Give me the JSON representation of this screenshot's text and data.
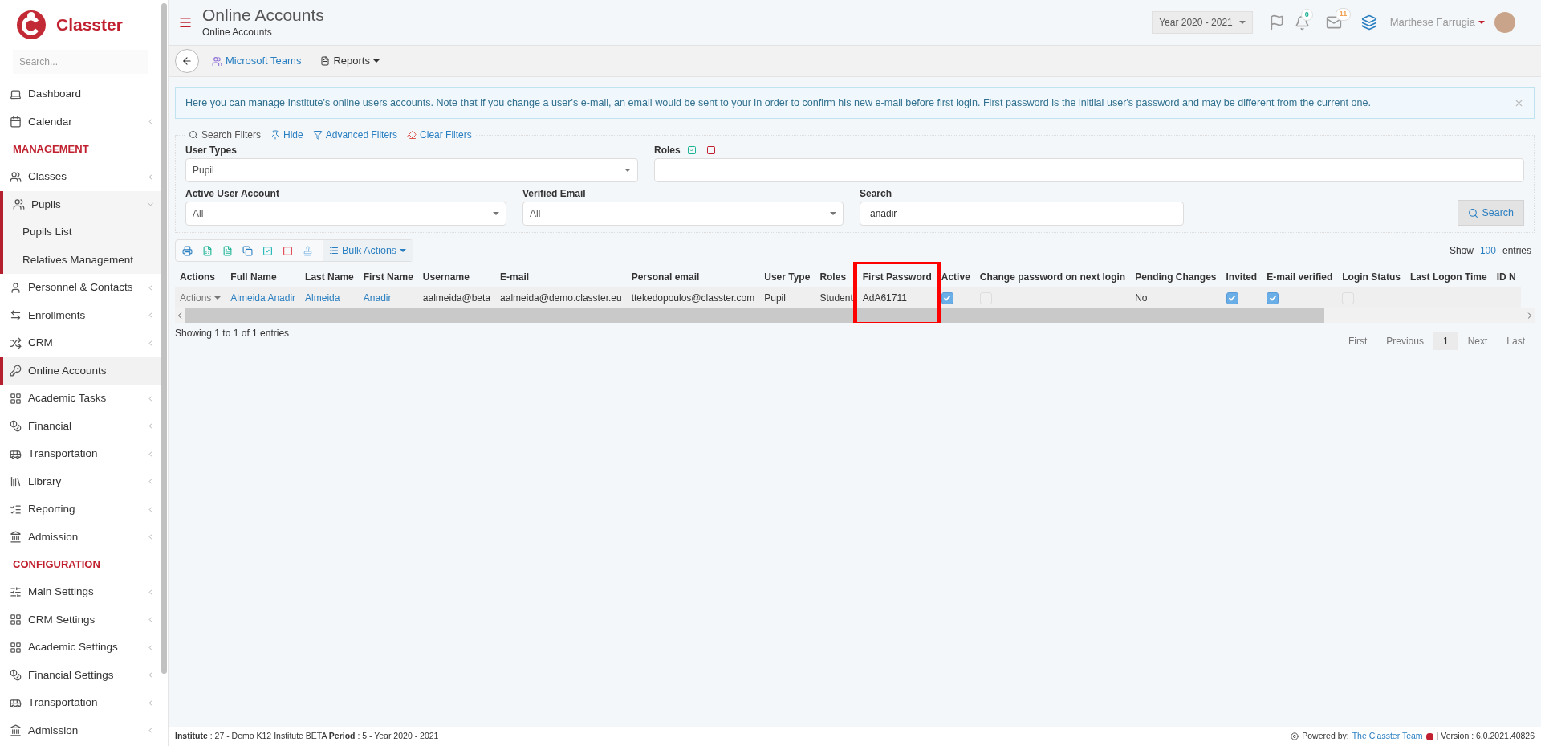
{
  "brand": {
    "name": "Classter"
  },
  "sidebar": {
    "search_placeholder": "Search...",
    "items": [
      {
        "kind": "item",
        "label": "Dashboard",
        "selected": false,
        "chevron": false
      },
      {
        "kind": "item",
        "label": "Calendar",
        "selected": false,
        "chevron": true
      },
      {
        "kind": "heading",
        "label": "MANAGEMENT"
      },
      {
        "kind": "item",
        "label": "Classes",
        "selected": false,
        "chevron": true
      },
      {
        "kind": "item",
        "label": "Pupils",
        "selected": false,
        "chevron": true,
        "expanded": true,
        "children": [
          {
            "label": "Pupils List"
          },
          {
            "label": "Relatives Management"
          }
        ]
      },
      {
        "kind": "item",
        "label": "Personnel & Contacts",
        "selected": false,
        "chevron": true
      },
      {
        "kind": "item",
        "label": "Enrollments",
        "selected": false,
        "chevron": true
      },
      {
        "kind": "item",
        "label": "CRM",
        "selected": false,
        "chevron": true
      },
      {
        "kind": "item",
        "label": "Online Accounts",
        "selected": true,
        "chevron": false
      },
      {
        "kind": "item",
        "label": "Academic Tasks",
        "selected": false,
        "chevron": true
      },
      {
        "kind": "item",
        "label": "Financial",
        "selected": false,
        "chevron": true
      },
      {
        "kind": "item",
        "label": "Transportation",
        "selected": false,
        "chevron": true
      },
      {
        "kind": "item",
        "label": "Library",
        "selected": false,
        "chevron": true
      },
      {
        "kind": "item",
        "label": "Reporting",
        "selected": false,
        "chevron": true
      },
      {
        "kind": "item",
        "label": "Admission",
        "selected": false,
        "chevron": true
      },
      {
        "kind": "heading",
        "label": "CONFIGURATION"
      },
      {
        "kind": "item",
        "label": "Main Settings",
        "selected": false,
        "chevron": true
      },
      {
        "kind": "item",
        "label": "CRM Settings",
        "selected": false,
        "chevron": true
      },
      {
        "kind": "item",
        "label": "Academic Settings",
        "selected": false,
        "chevron": true
      },
      {
        "kind": "item",
        "label": "Financial Settings",
        "selected": false,
        "chevron": true
      },
      {
        "kind": "item",
        "label": "Transportation",
        "selected": false,
        "chevron": true
      },
      {
        "kind": "item",
        "label": "Admission",
        "selected": false,
        "chevron": true
      }
    ]
  },
  "header": {
    "title": "Online Accounts",
    "subtitle": "Online Accounts",
    "year": "Year 2020 - 2021",
    "notifications": "0",
    "messages": "11",
    "user": "Marthese Farrugia"
  },
  "toolbar": {
    "teams": "Microsoft Teams",
    "reports": "Reports"
  },
  "info": "Here you can manage Institute's online users accounts. Note that if you change a user's e-mail, an email would be sent to your in order to confirm his new e-mail before first login. First password is the initiial user's password and may be different from the current one.",
  "filters": {
    "links": [
      "Search Filters",
      "Hide",
      "Advanced Filters",
      "Clear Filters"
    ],
    "user_types": {
      "label": "User Types",
      "value": "Pupil"
    },
    "roles": {
      "label": "Roles"
    },
    "active": {
      "label": "Active User Account",
      "value": "All"
    },
    "verified": {
      "label": "Verified Email",
      "value": "All"
    },
    "search": {
      "label": "Search",
      "value": "anadir"
    },
    "search_button": "Search"
  },
  "table": {
    "bulk": "Bulk Actions",
    "show": "Show",
    "page_size": "100",
    "entries": "entries",
    "columns": [
      {
        "label": "Actions",
        "highlighted": false
      },
      {
        "label": "Full Name",
        "highlighted": false
      },
      {
        "label": "Last Name",
        "highlighted": false
      },
      {
        "label": "First Name",
        "highlighted": false
      },
      {
        "label": "Username",
        "highlighted": false
      },
      {
        "label": "E-mail",
        "highlighted": false
      },
      {
        "label": "Personal email",
        "highlighted": false
      },
      {
        "label": "User Type",
        "highlighted": false
      },
      {
        "label": "Roles",
        "highlighted": false
      },
      {
        "label": "First Password",
        "highlighted": true
      },
      {
        "label": "Active",
        "highlighted": false
      },
      {
        "label": "Change password on next login",
        "highlighted": false
      },
      {
        "label": "Pending Changes",
        "highlighted": false
      },
      {
        "label": "Invited",
        "highlighted": false
      },
      {
        "label": "E-mail verified",
        "highlighted": false
      },
      {
        "label": "Login Status",
        "highlighted": false
      },
      {
        "label": "Last Logon Time",
        "highlighted": false
      },
      {
        "label": "ID N",
        "highlighted": false
      }
    ],
    "rows": [
      [
        {
          "kind": "menu",
          "text": "Actions"
        },
        {
          "kind": "link",
          "text": "Almeida Anadir"
        },
        {
          "kind": "link",
          "text": "Almeida"
        },
        {
          "kind": "link",
          "text": "Anadir"
        },
        {
          "kind": "text",
          "text": "aalmeida@beta"
        },
        {
          "kind": "text",
          "text": "aalmeida@demo.classter.eu"
        },
        {
          "kind": "text",
          "text": "ttekedopoulos@classter.com"
        },
        {
          "kind": "text",
          "text": "Pupil"
        },
        {
          "kind": "text",
          "text": "Student"
        },
        {
          "kind": "text",
          "text": "AdA61711"
        },
        {
          "kind": "check",
          "checked": true
        },
        {
          "kind": "check",
          "checked": false
        },
        {
          "kind": "text",
          "text": "No"
        },
        {
          "kind": "check",
          "checked": true
        },
        {
          "kind": "check",
          "checked": true
        },
        {
          "kind": "check",
          "checked": false
        },
        {
          "kind": "empty"
        },
        {
          "kind": "empty"
        }
      ]
    ],
    "summary": "Showing 1 to 1 of 1 entries",
    "pager": [
      {
        "label": "First",
        "selected": false
      },
      {
        "label": "Previous",
        "selected": false
      },
      {
        "label": "1",
        "selected": true
      },
      {
        "label": "Next",
        "selected": false
      },
      {
        "label": "Last",
        "selected": false
      }
    ]
  },
  "footer": {
    "left": "**Institute** : 27 - Demo K12 Institute BETA **Period** : 5 - Year 2020 - 2021",
    "powered": "Powered by:",
    "team": "The Classter Team",
    "version": "| Version : 6.0.2021.40826"
  }
}
